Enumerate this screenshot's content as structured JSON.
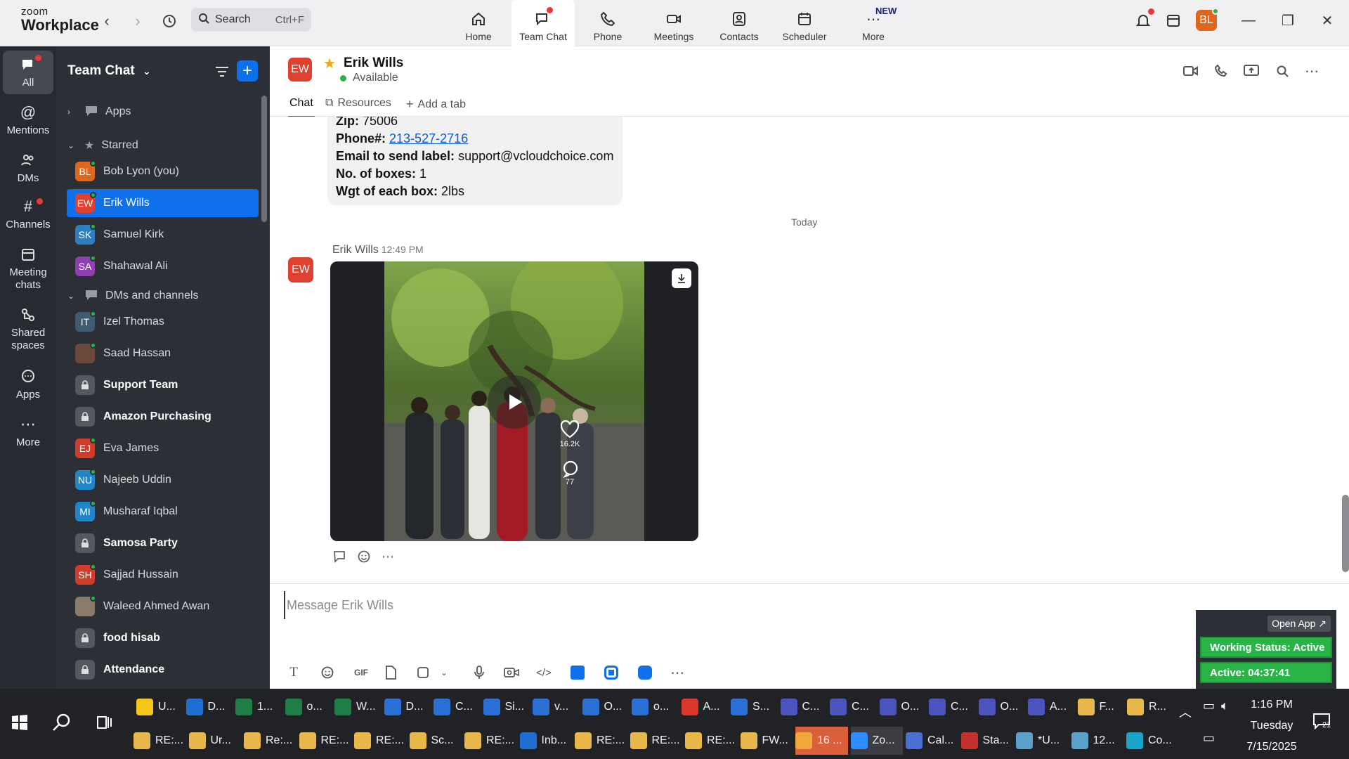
{
  "app": {
    "logo_line1": "zoom",
    "logo_line2": "Workplace",
    "accent": "#0e71eb"
  },
  "search": {
    "label": "Search",
    "shortcut": "Ctrl+F"
  },
  "nav": [
    {
      "label": "Home",
      "icon": "home-icon"
    },
    {
      "label": "Team Chat",
      "icon": "chat-icon",
      "active": true
    },
    {
      "label": "Phone",
      "icon": "phone-icon"
    },
    {
      "label": "Meetings",
      "icon": "video-camera-icon"
    },
    {
      "label": "Contacts",
      "icon": "contacts-icon"
    },
    {
      "label": "Scheduler",
      "icon": "calendar-icon"
    },
    {
      "label": "More",
      "icon": "more-icon",
      "badge": "NEW"
    }
  ],
  "profile": {
    "initials": "BL"
  },
  "rail": [
    {
      "label": "All",
      "active": true
    },
    {
      "label": "Mentions"
    },
    {
      "label": "DMs"
    },
    {
      "label": "Channels"
    },
    {
      "label": "Meeting chats"
    },
    {
      "label": "Shared spaces"
    },
    {
      "label": "Apps"
    },
    {
      "label": "More"
    }
  ],
  "sidebar": {
    "title": "Team Chat",
    "sections": {
      "apps": "Apps",
      "starred": "Starred",
      "dms": "DMs and channels"
    },
    "starred": [
      {
        "name": "Bob Lyon (you)",
        "initials": "BL",
        "color": "#e0661c"
      },
      {
        "name": "Erik Wills",
        "initials": "EW",
        "color": "#e0402f",
        "selected": true
      },
      {
        "name": "Samuel Kirk",
        "initials": "SK",
        "color": "#2d7fc1"
      },
      {
        "name": "Shahawal Ali",
        "initials": "SA",
        "color": "#8f3fb0"
      }
    ],
    "dms": [
      {
        "name": "Izel Thomas",
        "initials": "IT",
        "color": "#3f5a73"
      },
      {
        "name": "Saad Hassan",
        "initials": "",
        "color": "#6b4a3a"
      },
      {
        "name": "Support Team",
        "initials": "",
        "bold": true,
        "lock": true
      },
      {
        "name": "Amazon Purchasing",
        "initials": "",
        "bold": true,
        "lock": true
      },
      {
        "name": "Eva James",
        "initials": "EJ",
        "color": "#d23a2a"
      },
      {
        "name": "Najeeb Uddin",
        "initials": "NU",
        "color": "#1f86c9"
      },
      {
        "name": "Musharaf Iqbal",
        "initials": "MI",
        "color": "#1f86c9"
      },
      {
        "name": "Samosa Party",
        "initials": "",
        "bold": true,
        "lock": true
      },
      {
        "name": "Sajjad Hussain",
        "initials": "SH",
        "color": "#d23a2a"
      },
      {
        "name": "Waleed Ahmed Awan",
        "initials": "",
        "color": "#8a7b6a"
      },
      {
        "name": "food hisab",
        "initials": "",
        "bold": true,
        "lock": true
      },
      {
        "name": "Attendance",
        "initials": "",
        "bold": true,
        "lock": true
      }
    ]
  },
  "chat": {
    "contact_name": "Erik Wills",
    "contact_initials": "EW",
    "status": "Available",
    "tabs": [
      "Chat",
      "Resources",
      "Add a tab"
    ],
    "card": {
      "zip_label": "Zip:",
      "zip_value": "75006",
      "phone_label": "Phone#:",
      "phone_value": "213-527-2716",
      "email_label": "Email to send label:",
      "email_value": "support@vcloudchoice.com",
      "boxes_label": "No. of boxes:",
      "boxes_value": "1",
      "weight_label": "Wgt of each box:",
      "weight_value": "2lbs"
    },
    "date_divider": "Today",
    "message": {
      "sender": "Erik Wills",
      "time": "12:49 PM",
      "likes": "16.2K",
      "comments": "77"
    },
    "composer_placeholder": "Message Erik Wills"
  },
  "widget": {
    "open_app": "Open App ↗",
    "working_status": "Working Status: Active",
    "active_time": "Active: 04:37:41"
  },
  "taskbar": {
    "row1": [
      "U...",
      "D...",
      "1...",
      "o...",
      "W...",
      "D...",
      "C...",
      "Si...",
      "v...",
      "O...",
      "o...",
      "A...",
      "S...",
      "C...",
      "C...",
      "O...",
      "C...",
      "O...",
      "A...",
      "F...",
      "R..."
    ],
    "row2": [
      "RE:...",
      "Ur...",
      "Re:...",
      "RE:...",
      "RE:...",
      "Sc...",
      "RE:...",
      "Inb...",
      "RE:...",
      "RE:...",
      "RE:...",
      "FW...",
      "16 ...",
      "Zo...",
      "Cal...",
      "Sta...",
      "*U...",
      "12...",
      "Co..."
    ],
    "time": "1:16 PM",
    "day": "Tuesday",
    "date": "7/15/2025",
    "notif_count": "21"
  }
}
